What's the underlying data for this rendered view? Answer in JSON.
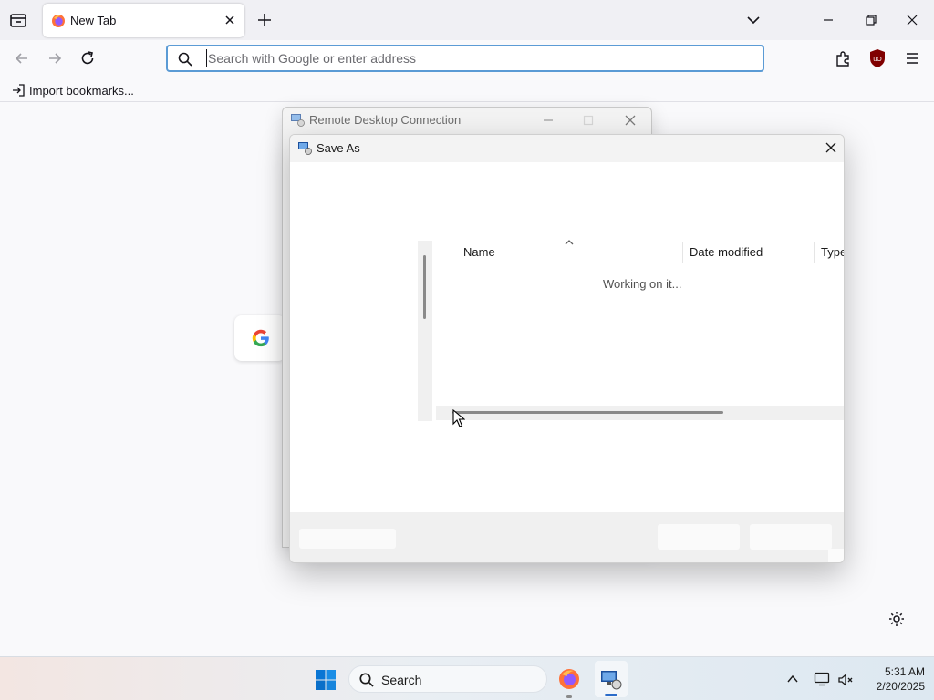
{
  "browser": {
    "tab": {
      "title": "New Tab"
    },
    "urlbar": {
      "placeholder": "Search with Google or enter address"
    },
    "bookmarks": {
      "import_label": "Import bookmarks..."
    }
  },
  "rdc": {
    "title": "Remote Desktop Connection"
  },
  "save_as": {
    "title": "Save As",
    "columns": [
      "Name",
      "Date modified",
      "Type"
    ],
    "status": "Working on it..."
  },
  "taskbar": {
    "search_label": "Search",
    "time": "5:31 AM",
    "date": "2/20/2025"
  },
  "colors": {
    "accent": "#2a6bc9",
    "urlbar_border": "#5b9bd5",
    "ublock": "#800000"
  }
}
